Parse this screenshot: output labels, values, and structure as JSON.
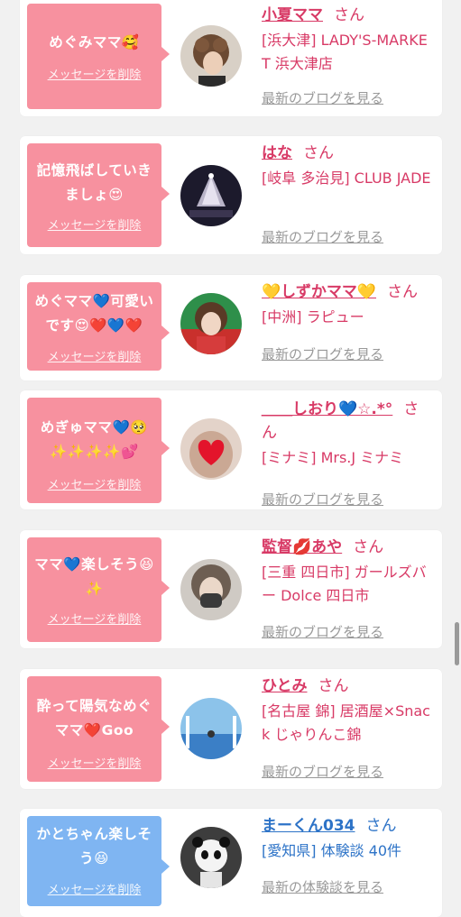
{
  "items": [
    {
      "message": "めぐみママ🥰",
      "delete_label": "メッセージを削除",
      "avatar": "avatar-woman-curly-hair",
      "name": "小夏ママ",
      "honorific": "さん",
      "shop": "[浜大津] LADY'S-MARKET 浜大津店",
      "link": "最新のブログを見る",
      "color": "pink"
    },
    {
      "message": "記憶飛ばしていきましょ😍",
      "delete_label": "メッセージを削除",
      "avatar": "avatar-chandelier",
      "name": "はな",
      "honorific": "さん",
      "shop": "[岐阜 多治見] CLUB JADE",
      "link": "最新のブログを見る",
      "color": "pink"
    },
    {
      "message": "めぐママ💙可愛いです😍❤️💙❤️",
      "delete_label": "メッセージを削除",
      "avatar": "avatar-woman-selfie",
      "name": "💛しずかママ💛",
      "honorific": "さん",
      "shop": "[中洲] ラピュー",
      "link": "最新のブログを見る",
      "color": "pink"
    },
    {
      "message": "めぎゅママ💙🥺✨✨✨✨💕",
      "delete_label": "メッセージを削除",
      "avatar": "avatar-heart-cover",
      "name": "＿＿しおり💙☆.*°",
      "honorific": "さん",
      "shop": "[ミナミ] Mrs.J ミナミ",
      "link": "最新のブログを見る",
      "color": "pink"
    },
    {
      "message": "ママ💙楽しそう😆✨",
      "delete_label": "メッセージを削除",
      "avatar": "avatar-woman-mask",
      "name": "監督💋あや",
      "honorific": "さん",
      "shop": "[三重 四日市] ガールズバー Dolce 四日市",
      "link": "最新のブログを見る",
      "color": "pink"
    },
    {
      "message": "酔って陽気なめぐママ❤️Goo",
      "delete_label": "メッセージを削除",
      "avatar": "avatar-beach-sky",
      "name": "ひとみ",
      "honorific": "さん",
      "shop": "[名古屋 錦] 居酒屋×Snack じゃりんこ錦",
      "link": "最新のブログを見る",
      "color": "pink"
    },
    {
      "message": "かとちゃん楽しそう😆",
      "delete_label": "メッセージを削除",
      "avatar": "avatar-panda-toy",
      "name": "まーくん034",
      "honorific": "さん",
      "shop": "[愛知県] 体験談 40件",
      "link": "最新の体験談を見る",
      "color": "blue"
    }
  ]
}
